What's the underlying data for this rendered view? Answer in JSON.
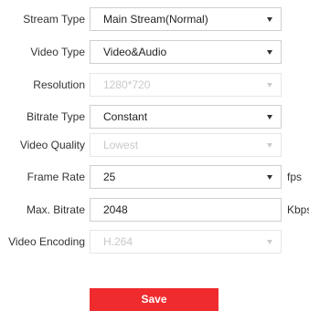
{
  "form": {
    "rows": [
      {
        "label": "Stream Type",
        "value": "Main Stream(Normal)",
        "disabled": false
      },
      {
        "label": "Video Type",
        "value": "Video&Audio",
        "disabled": false
      },
      {
        "label": "Resolution",
        "value": "1280*720",
        "disabled": true
      },
      {
        "label": "Bitrate Type",
        "value": "Constant",
        "disabled": false
      },
      {
        "label": "Video Quality",
        "value": "Lowest",
        "disabled": true
      },
      {
        "label": "Frame Rate",
        "value": "25",
        "unit": "fps",
        "disabled": false
      },
      {
        "label": "Max. Bitrate",
        "value": "2048",
        "unit": "Kbps",
        "disabled": false
      },
      {
        "label": "Video Encoding",
        "value": "H.264",
        "disabled": true
      }
    ],
    "save_label": "Save"
  },
  "colors": {
    "accent": "#ef2b2e",
    "border": "#cfcfcf",
    "disabled_text": "#c8c8c8"
  }
}
